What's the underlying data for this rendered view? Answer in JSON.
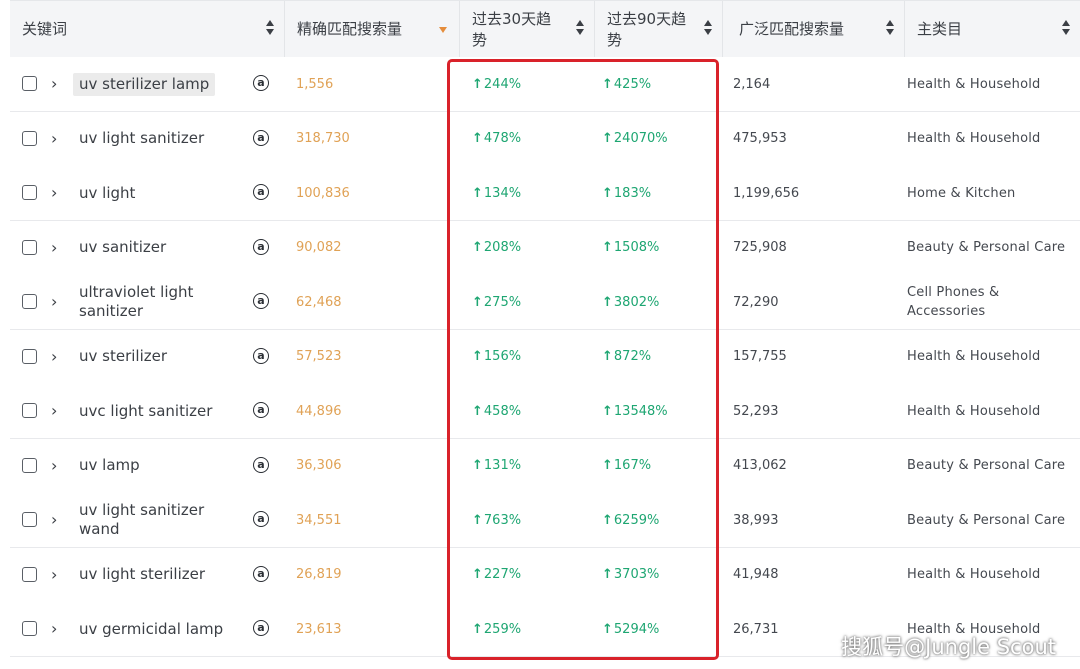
{
  "header": {
    "keyword": "关键词",
    "exact_volume": "精确匹配搜索量",
    "trend_30": "过去30天趋势",
    "trend_90": "过去90天趋势",
    "broad_volume": "广泛匹配搜索量",
    "category": "主类目"
  },
  "rows": [
    {
      "keyword": "uv sterilizer lamp",
      "exact": "1,556",
      "t30": "244%",
      "t90": "425%",
      "broad": "2,164",
      "category": "Health & Household"
    },
    {
      "keyword": "uv light sanitizer",
      "exact": "318,730",
      "t30": "478%",
      "t90": "24070%",
      "broad": "475,953",
      "category": "Health & Household"
    },
    {
      "keyword": "uv light",
      "exact": "100,836",
      "t30": "134%",
      "t90": "183%",
      "broad": "1,199,656",
      "category": "Home & Kitchen"
    },
    {
      "keyword": "uv sanitizer",
      "exact": "90,082",
      "t30": "208%",
      "t90": "1508%",
      "broad": "725,908",
      "category": "Beauty & Personal Care"
    },
    {
      "keyword": "ultraviolet light sanitizer",
      "exact": "62,468",
      "t30": "275%",
      "t90": "3802%",
      "broad": "72,290",
      "category": "Cell Phones & Accessories"
    },
    {
      "keyword": "uv sterilizer",
      "exact": "57,523",
      "t30": "156%",
      "t90": "872%",
      "broad": "157,755",
      "category": "Health & Household"
    },
    {
      "keyword": "uvc light sanitizer",
      "exact": "44,896",
      "t30": "458%",
      "t90": "13548%",
      "broad": "52,293",
      "category": "Health & Household"
    },
    {
      "keyword": "uv lamp",
      "exact": "36,306",
      "t30": "131%",
      "t90": "167%",
      "broad": "413,062",
      "category": "Beauty & Personal Care"
    },
    {
      "keyword": "uv light sanitizer wand",
      "exact": "34,551",
      "t30": "763%",
      "t90": "6259%",
      "broad": "38,993",
      "category": "Beauty & Personal Care"
    },
    {
      "keyword": "uv light sterilizer",
      "exact": "26,819",
      "t30": "227%",
      "t90": "3703%",
      "broad": "41,948",
      "category": "Health & Household"
    },
    {
      "keyword": "uv germicidal lamp",
      "exact": "23,613",
      "t30": "259%",
      "t90": "5294%",
      "broad": "26,731",
      "category": "Health & Household"
    }
  ],
  "icons": {
    "expand": "chevron-right-icon",
    "amazon": "amazon-icon",
    "trend": "arrow-up-icon"
  },
  "colors": {
    "exact_volume": "#e0a256",
    "trend_up": "#1ea672",
    "highlight_box": "#d9222a"
  },
  "watermark": "搜狐号@Jungle Scout"
}
